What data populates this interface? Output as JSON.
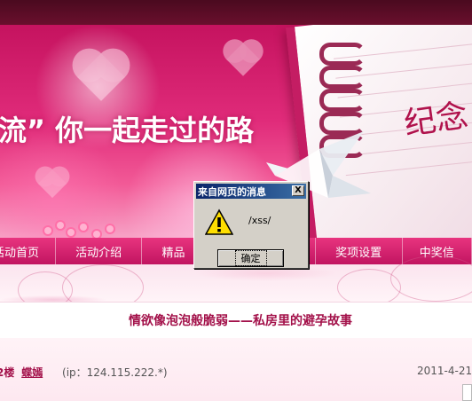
{
  "banner": {
    "slogan": "流” 你一起走过的路",
    "script_text": "纪念"
  },
  "nav": {
    "items": [
      {
        "label": "活动首页"
      },
      {
        "label": "活动介绍"
      },
      {
        "label": "精品"
      },
      {
        "label": ""
      },
      {
        "label": "奖项设置"
      },
      {
        "label": "中奖信"
      }
    ]
  },
  "post": {
    "title": "情欲像泡泡般脆弱——私房里的避孕故事",
    "floor": "2楼",
    "author": "蝶嫣",
    "ip": "(ip：124.115.222.*)",
    "date": "2011-4-21"
  },
  "dialog": {
    "title": "来自网页的消息",
    "close_label": "X",
    "icon": "warning-icon",
    "message": "/xss/",
    "ok_label": "确定"
  },
  "colors": {
    "nav_bg": "#d21f6c",
    "title_text": "#a3114a",
    "dialog_titlebar": "#0a246a",
    "dialog_bg": "#d4d0c8"
  }
}
